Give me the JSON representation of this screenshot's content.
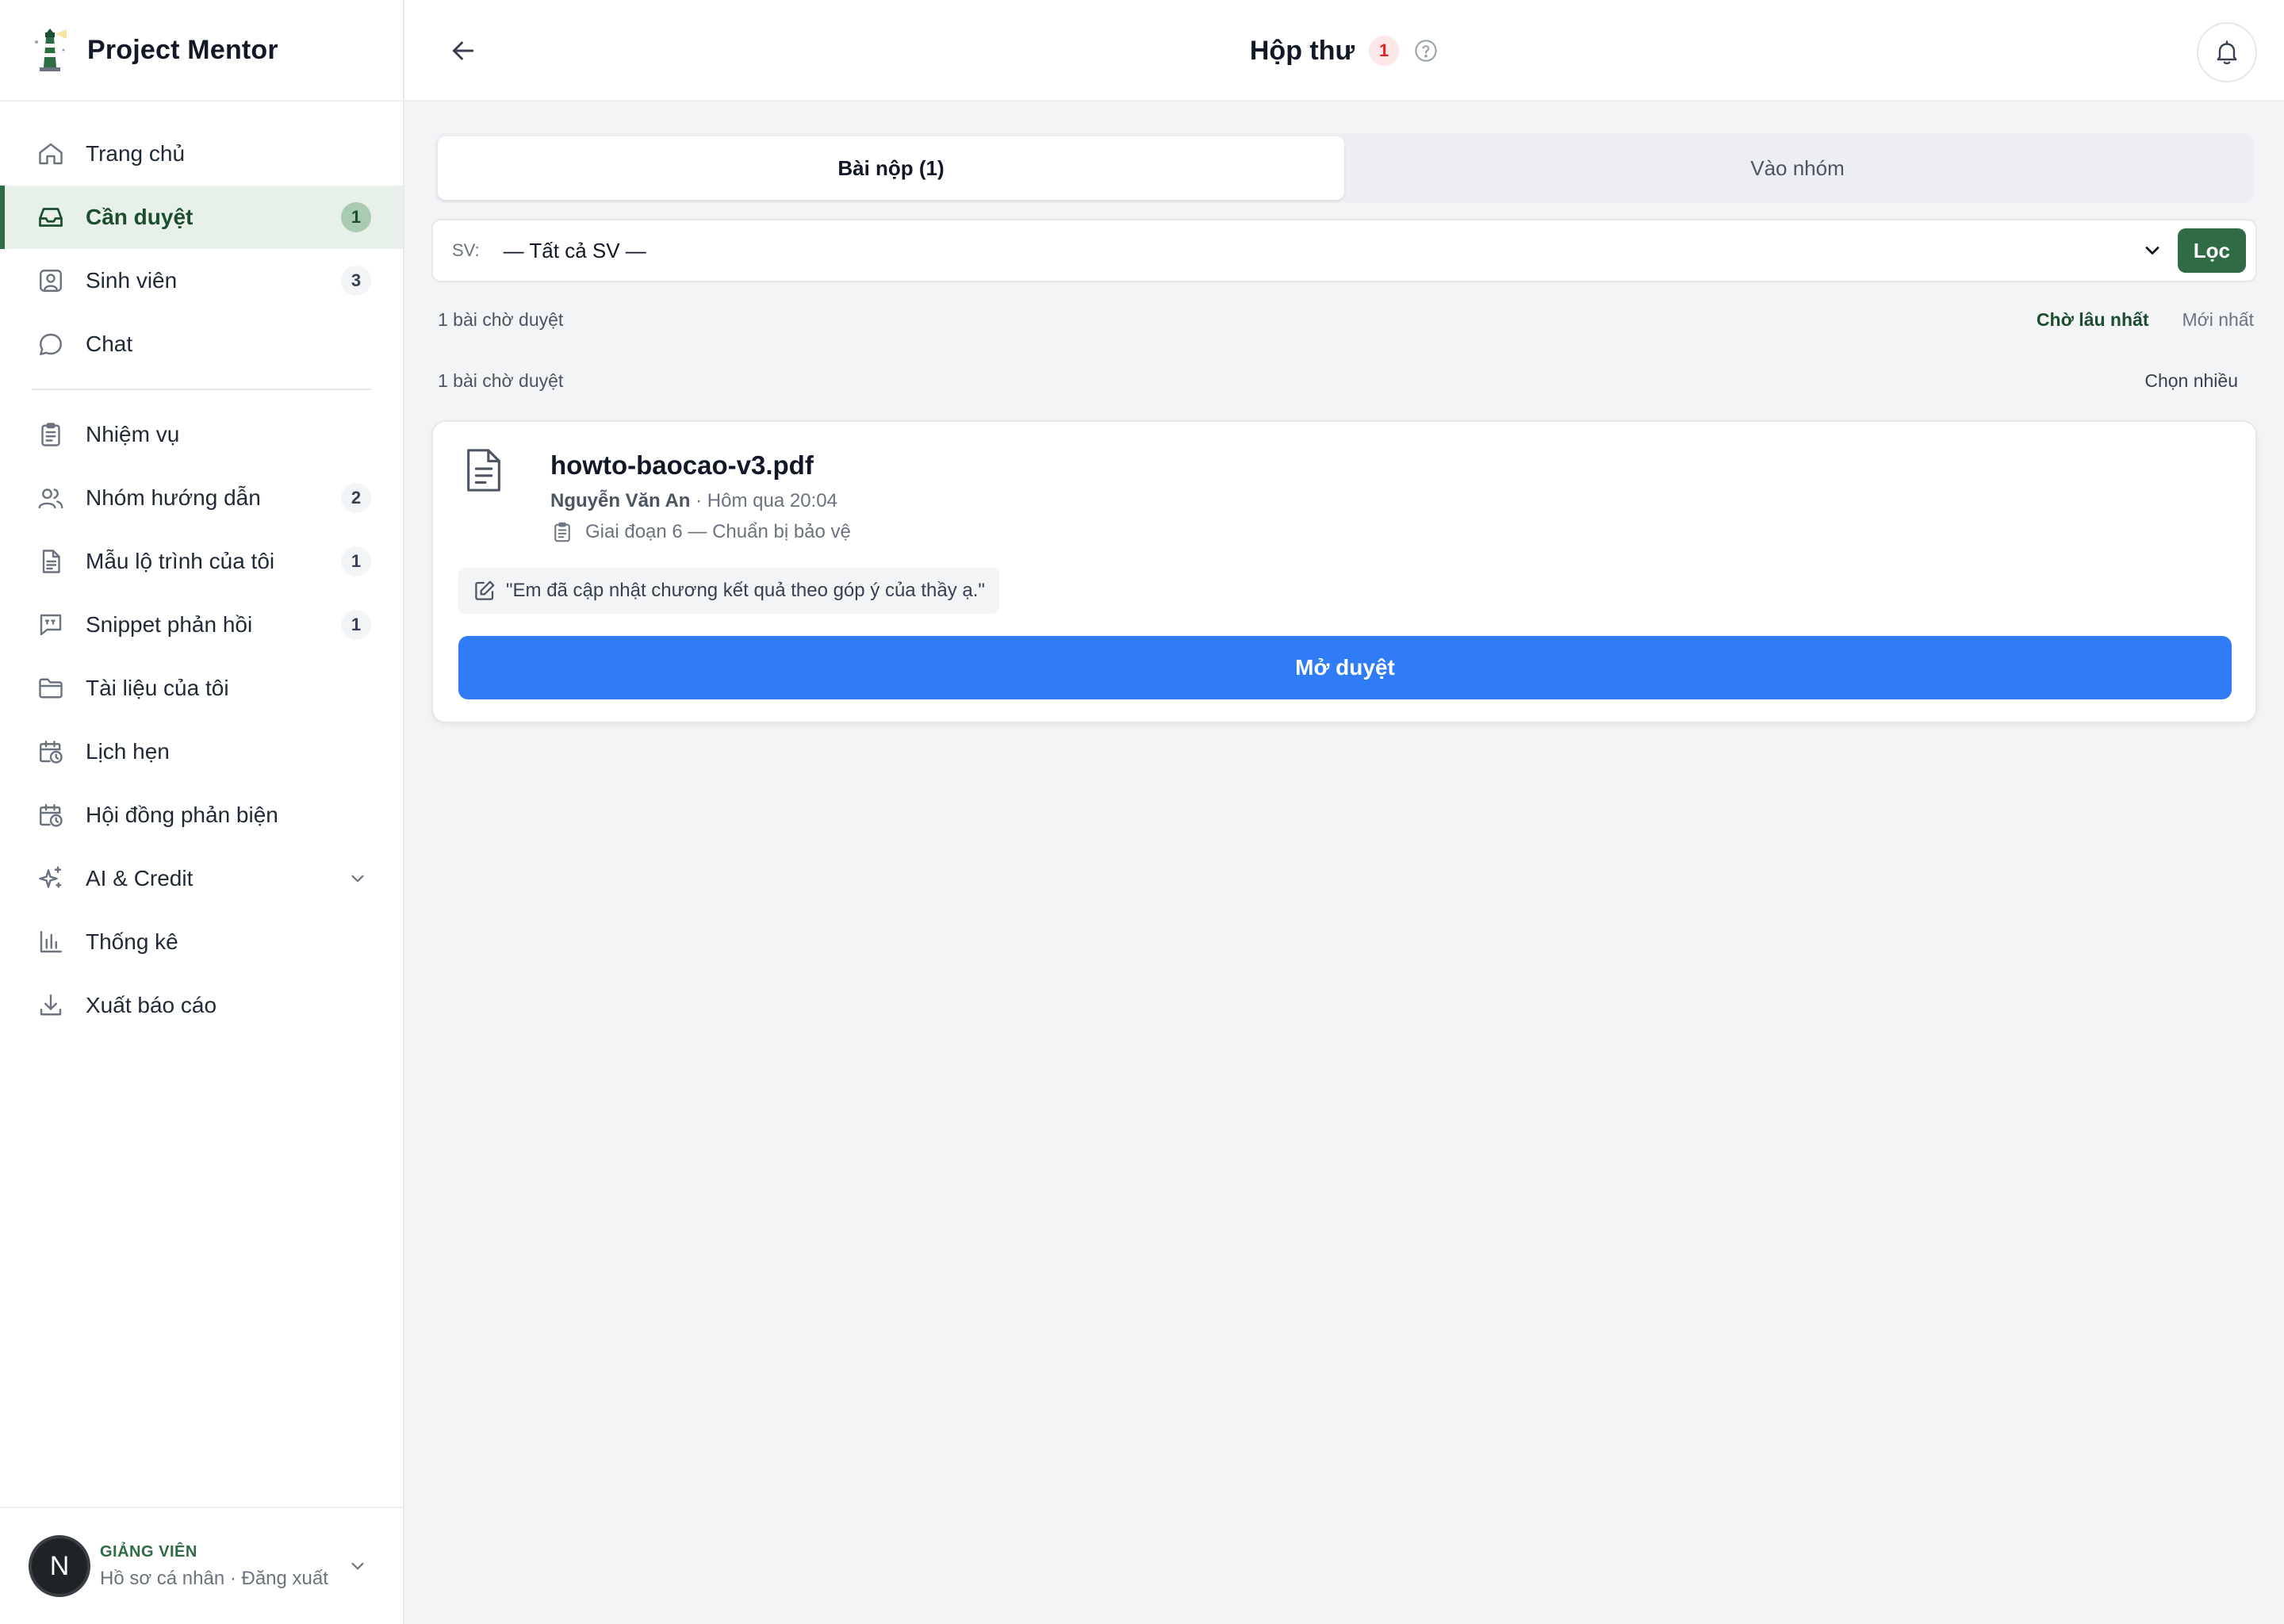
{
  "app": {
    "name": "Project Mentor"
  },
  "sidebar": {
    "items": [
      {
        "label": "Trang chủ",
        "icon": "home-icon",
        "badge": ""
      },
      {
        "label": "Cần duyệt",
        "icon": "inbox-icon",
        "badge": "1",
        "active": true
      },
      {
        "label": "Sinh viên",
        "icon": "user-square-icon",
        "badge": "3"
      },
      {
        "label": "Chat",
        "icon": "chat-icon",
        "badge": ""
      },
      {
        "label": "Nhiệm vụ",
        "icon": "clipboard-icon",
        "badge": ""
      },
      {
        "label": "Nhóm hướng dẫn",
        "icon": "users-icon",
        "badge": "2"
      },
      {
        "label": "Mẫu lộ trình của tôi",
        "icon": "document-icon",
        "badge": "1"
      },
      {
        "label": "Snippet phản hồi",
        "icon": "quote-message-icon",
        "badge": "1"
      },
      {
        "label": "Tài liệu của tôi",
        "icon": "folder-icon",
        "badge": ""
      },
      {
        "label": "Lịch hẹn",
        "icon": "calendar-clock-icon",
        "badge": ""
      },
      {
        "label": "Hội đồng phản biện",
        "icon": "calendar-clock-icon",
        "badge": ""
      },
      {
        "label": "AI & Credit",
        "icon": "sparkles-icon",
        "badge": ""
      },
      {
        "label": "Thống kê",
        "icon": "bar-chart-icon",
        "badge": ""
      },
      {
        "label": "Xuất báo cáo",
        "icon": "download-icon",
        "badge": ""
      }
    ]
  },
  "user": {
    "initial": "N",
    "role": "GIẢNG VIÊN",
    "links": "Hồ sơ cá nhân · Đăng xuất"
  },
  "header": {
    "title": "Hộp thư",
    "badge": "1"
  },
  "tabs": [
    {
      "label": "Bài nộp (1)",
      "active": true
    },
    {
      "label": "Vào nhóm",
      "active": false
    }
  ],
  "filter": {
    "label": "SV:",
    "selected": "— Tất cả SV —",
    "button": "Lọc"
  },
  "summary": {
    "count_text": "1 bài chờ duyệt",
    "sort_options": [
      "Chờ lâu nhất",
      "Mới nhất"
    ],
    "sort_active": "Chờ lâu nhất",
    "count_text_2": "1 bài chờ duyệt",
    "multi_select": "Chọn nhiều"
  },
  "submission": {
    "file_name": "howto-baocao-v3.pdf",
    "author": "Nguyễn Văn An",
    "time": " · Hôm qua 20:04",
    "stage": "Giai đoạn 6 — Chuẩn bị bảo vệ",
    "note": "\"Em đã cập nhật chương kết quả theo góp ý của thầy ạ.\"",
    "open_button": "Mở duyệt"
  },
  "colors": {
    "accent_green": "#2f6b45",
    "primary_blue": "#2f7cf6",
    "badge_red": "#dc2626"
  }
}
